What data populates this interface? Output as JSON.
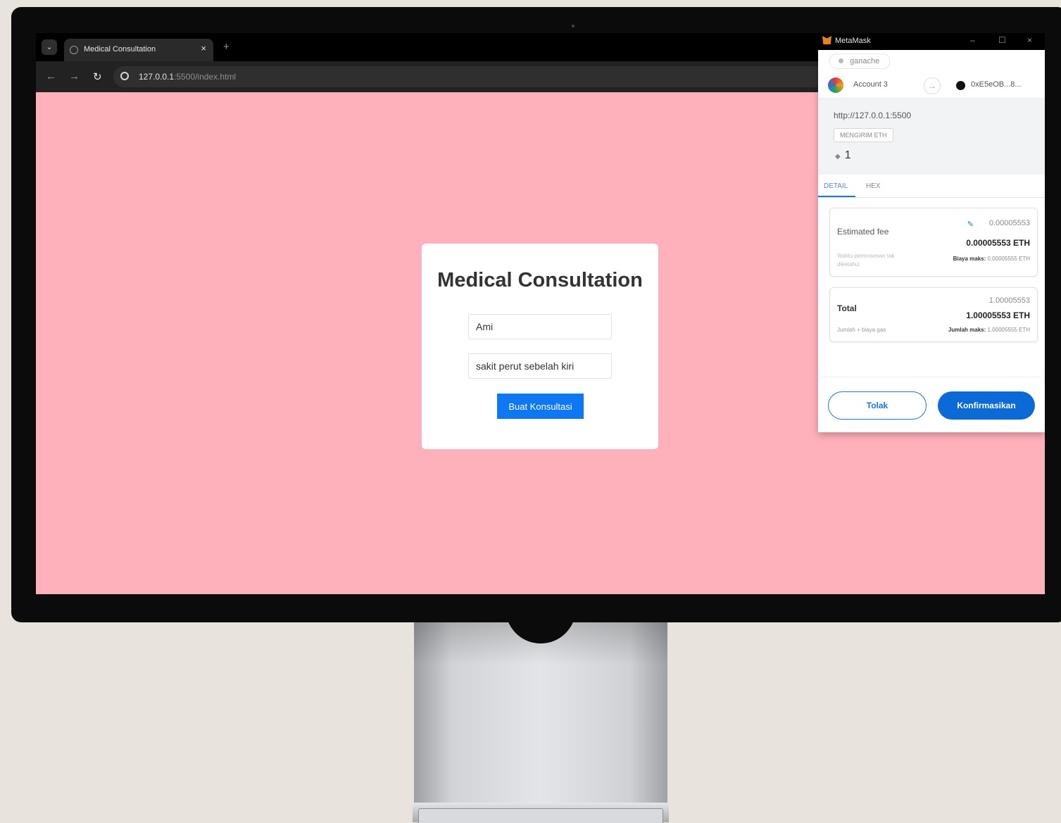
{
  "browser": {
    "tab_title": "Medical Consultation",
    "url_host": "127.0.0.1",
    "url_rest": ":5500/index.html"
  },
  "form": {
    "title": "Medical Consultation",
    "name_value": "Ami",
    "symptom_value": "sakit perut sebelah kiri",
    "submit_label": "Buat Konsultasi"
  },
  "metamask": {
    "window_title": "MetaMask",
    "network": "ganache",
    "account": "Account 3",
    "address": "0xE5eOB...8...",
    "origin": "http://127.0.0.1:5500",
    "action_badge": "MENGIRIM ETH",
    "amount": "1",
    "tabs": [
      "DETAIL",
      "HEX"
    ],
    "fee": {
      "label": "Estimated fee",
      "value_small": "0.00005553",
      "value_big": "0.00005553 ETH",
      "foot_left": "Waktu pemrosesan tak diketahui",
      "max_label": "Biaya maks:",
      "max_value": "0.00005555 ETH"
    },
    "total": {
      "label": "Total",
      "value_small": "1.00005553",
      "value_big": "1.00005553 ETH",
      "foot_left": "Jumlah + biaya gas",
      "max_label": "Jumlah maks:",
      "max_value": "1.00005555 ETH"
    },
    "reject_label": "Tolak",
    "confirm_label": "Konfirmasikan"
  }
}
